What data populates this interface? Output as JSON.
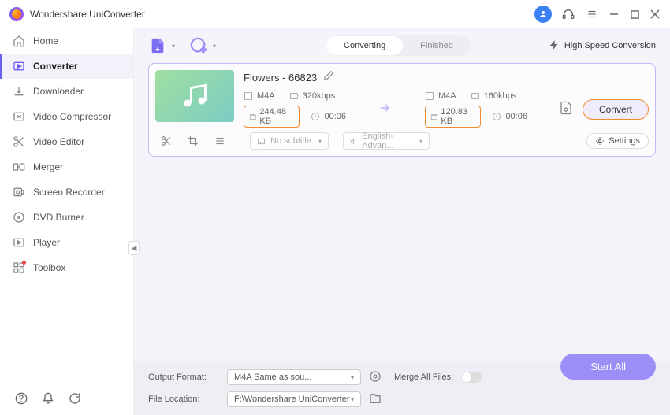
{
  "app": {
    "title": "Wondershare UniConverter"
  },
  "sidebar": {
    "items": [
      {
        "label": "Home"
      },
      {
        "label": "Converter"
      },
      {
        "label": "Downloader"
      },
      {
        "label": "Video Compressor"
      },
      {
        "label": "Video Editor"
      },
      {
        "label": "Merger"
      },
      {
        "label": "Screen Recorder"
      },
      {
        "label": "DVD Burner"
      },
      {
        "label": "Player"
      },
      {
        "label": "Toolbox"
      }
    ]
  },
  "tabs": {
    "converting": "Converting",
    "finished": "Finished"
  },
  "toolbar": {
    "highspeed": "High Speed Conversion"
  },
  "file": {
    "title": "Flowers - 66823",
    "src": {
      "format": "M4A",
      "bitrate": "320kbps",
      "size": "244.48 KB",
      "duration": "00:06"
    },
    "dst": {
      "format": "M4A",
      "bitrate": "160kbps",
      "size": "120.83 KB",
      "duration": "00:06"
    },
    "convert": "Convert",
    "subtitle": "No subtitle",
    "audio": "English-Advan...",
    "settings": "Settings"
  },
  "bottom": {
    "output_format_label": "Output Format:",
    "output_format_value": "M4A Same as sou...",
    "file_location_label": "File Location:",
    "file_location_value": "F:\\Wondershare UniConverter",
    "merge_label": "Merge All Files:",
    "start_all": "Start All"
  }
}
